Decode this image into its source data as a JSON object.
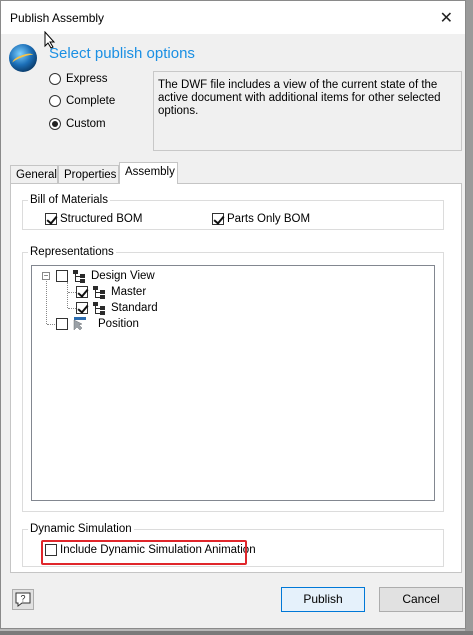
{
  "window": {
    "title": "Publish Assembly",
    "close_glyph": "✕"
  },
  "heading": "Select publish options",
  "publish_mode": {
    "options": [
      {
        "label": "Express",
        "selected": false
      },
      {
        "label": "Complete",
        "selected": false
      },
      {
        "label": "Custom",
        "selected": true
      }
    ]
  },
  "description": "The DWF file includes a view of the current state of the active document with additional items for other selected options.",
  "tabs": [
    {
      "label": "General",
      "active": false
    },
    {
      "label": "Properties",
      "active": false
    },
    {
      "label": "Assembly",
      "active": true
    }
  ],
  "bom": {
    "group_label": "Bill of Materials",
    "structured_label": "Structured BOM",
    "structured_checked": true,
    "parts_only_label": "Parts Only BOM",
    "parts_only_checked": true
  },
  "representations": {
    "group_label": "Representations",
    "tree": {
      "design_view": {
        "label": "Design View",
        "checked": false,
        "expander": "−"
      },
      "master": {
        "label": "Master",
        "checked": true
      },
      "standard": {
        "label": "Standard",
        "checked": true
      },
      "position": {
        "label": "Position",
        "checked": false
      }
    }
  },
  "dynamic_sim": {
    "group_label": "Dynamic Simulation",
    "animation_label": "Include Dynamic Simulation Animation",
    "animation_checked": false
  },
  "buttons": {
    "help_glyph": "?",
    "publish": "Publish",
    "cancel": "Cancel"
  },
  "colors": {
    "accent": "#1a8fe3",
    "highlight": "#e0262b",
    "primary_border": "#0078d7"
  }
}
